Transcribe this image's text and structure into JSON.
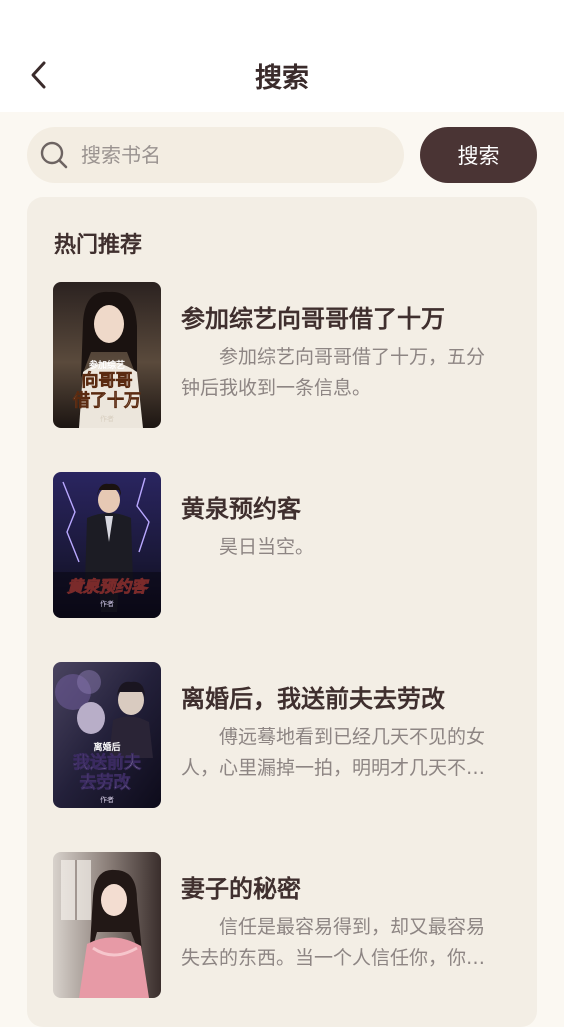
{
  "header": {
    "title": "搜索"
  },
  "search": {
    "placeholder": "搜索书名",
    "value": "",
    "button_label": "搜索"
  },
  "recommend": {
    "title": "热门推荐",
    "books": [
      {
        "title": "参加综艺向哥哥借了十万",
        "desc": "参加综艺向哥哥借了十万，五分钟后我收到一条信息。"
      },
      {
        "title": "黄泉预约客",
        "desc": "昊日当空。"
      },
      {
        "title": "离婚后，我送前夫去劳改",
        "desc": "傅远蓦地看到已经几天不见的女人，心里漏掉一拍，明明才几天不见，他却觉得已经过了很久。"
      },
      {
        "title": "妻子的秘密",
        "desc": "信任是最容易得到，却又最容易失去的东西。当一个人信任你，你就要好好珍惜。"
      }
    ]
  },
  "covers": [
    {
      "text": "向哥哥借了十万",
      "small": "参加综艺",
      "author": "作者"
    },
    {
      "text": "黄泉预约客",
      "small": "",
      "author": "作者"
    },
    {
      "text": "我送前夫去劳改",
      "small": "离婚后",
      "author": "作者"
    },
    {
      "text": "",
      "small": "",
      "author": ""
    }
  ]
}
